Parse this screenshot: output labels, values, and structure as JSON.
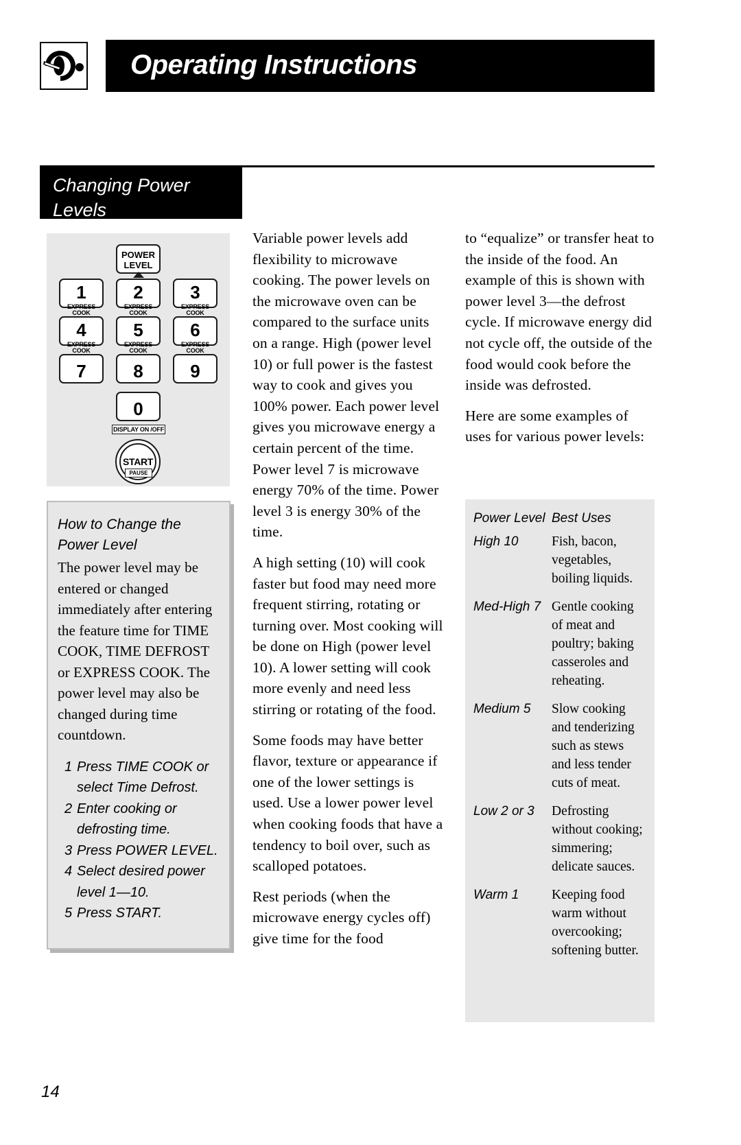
{
  "header": {
    "icon": "microwave-door-knob-icon",
    "title": "Operating Instructions"
  },
  "section": {
    "tab_title": "Changing Power\nLevels"
  },
  "keypad": {
    "power_level_line1": "POWER",
    "power_level_line2": "LEVEL",
    "express_cook_label": "EXPRESS COOK",
    "keys": [
      {
        "num": "1",
        "sub": "EXPRESS COOK"
      },
      {
        "num": "2",
        "sub": "EXPRESS COOK"
      },
      {
        "num": "3",
        "sub": "EXPRESS COOK"
      },
      {
        "num": "4",
        "sub": "EXPRESS COOK"
      },
      {
        "num": "5",
        "sub": "EXPRESS COOK"
      },
      {
        "num": "6",
        "sub": "EXPRESS COOK"
      },
      {
        "num": "7",
        "sub": ""
      },
      {
        "num": "8",
        "sub": ""
      },
      {
        "num": "9",
        "sub": ""
      },
      {
        "num": "0",
        "sub": ""
      }
    ],
    "display_on_off": "DISPLAY ON /OFF",
    "start_label": "START",
    "pause_label": "PAUSE"
  },
  "howto": {
    "title": "How to Change the Power Level",
    "body": "The power level may be entered or changed immediately after entering the feature time for TIME COOK, TIME DEFROST or EXPRESS COOK. The power level may also be changed during time countdown.",
    "steps": [
      {
        "num": "1",
        "text": "Press TIME COOK or\nselect Time Defrost."
      },
      {
        "num": "2",
        "text": "Enter cooking or\ndefrosting time."
      },
      {
        "num": "3",
        "text": "Press POWER LEVEL."
      },
      {
        "num": "4",
        "text": "Select desired power\nlevel 1—10."
      },
      {
        "num": "5",
        "text": "Press START."
      }
    ]
  },
  "middle_column": {
    "paragraphs": [
      "Variable power levels add flexibility to microwave cooking. The power levels on the microwave oven can be compared to the surface units on a range. High (power level 10) or full power is the fastest way to cook and gives you 100% power. Each power level gives you microwave energy a certain percent of the time. Power level 7 is microwave energy 70% of the time. Power level 3 is energy 30% of the time.",
      "A high setting (10) will cook faster but food may need more frequent stirring, rotating or turning over. Most cooking will be done on High (power level 10). A lower setting will cook more evenly and need less stirring or rotating of the food.",
      "Some foods may have better flavor, texture or appearance if one of the lower settings is used. Use a lower power level when cooking foods that have a tendency to boil over, such as scalloped potatoes.",
      "Rest periods (when the microwave energy cycles off) give time for the food"
    ]
  },
  "right_column": {
    "paragraphs": [
      "to “equalize” or transfer heat to the inside of the food. An example of this is shown with power level 3—the defrost cycle. If microwave energy did not cycle off, the outside of the food would cook before the inside was defrosted.",
      "Here are some examples of uses for various power levels:"
    ]
  },
  "uses_table": {
    "header_level": "Power Level",
    "header_uses": "Best Uses",
    "rows": [
      {
        "level": "High 10",
        "use": "Fish, bacon, vegetables, boiling liquids."
      },
      {
        "level": "Med-High 7",
        "use": "Gentle cooking of meat and poultry; baking casseroles and reheating."
      },
      {
        "level": "Medium 5",
        "use": "Slow cooking and tenderizing such as stews and less tender cuts of meat."
      },
      {
        "level": "Low 2 or 3",
        "use": "Defrosting without cooking; simmering; delicate sauces."
      },
      {
        "level": "Warm 1",
        "use": "Keeping food warm without overcooking; softening butter."
      }
    ]
  },
  "footer": {
    "page_number": "14"
  }
}
